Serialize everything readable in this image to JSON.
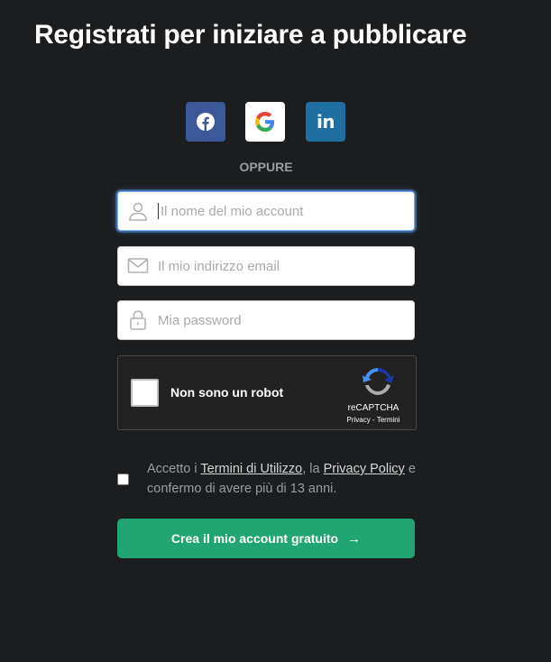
{
  "header": {
    "title": "Registrati per iniziare a pubblicare"
  },
  "social": {
    "facebook": {
      "icon": "facebook-icon",
      "color": "#3b5998"
    },
    "google": {
      "icon": "google-icon",
      "color": "#ffffff"
    },
    "linkedin": {
      "icon": "linkedin-icon",
      "label": "in",
      "color": "#1f6fa3"
    },
    "separator": "OPPURE"
  },
  "form": {
    "account_name": {
      "placeholder": "Il nome del mio account",
      "value": "",
      "icon": "user-icon"
    },
    "email": {
      "placeholder": "Il mio indirizzo email",
      "value": "",
      "icon": "envelope-icon"
    },
    "password": {
      "placeholder": "Mia password",
      "value": "",
      "icon": "lock-icon"
    }
  },
  "captcha": {
    "label": "Non sono un robot",
    "brand": "reCAPTCHA",
    "privacy": "Privacy",
    "sep": " - ",
    "terms": "Termini"
  },
  "terms": {
    "prefix": "Accetto i ",
    "link1": "Termini di Utilizzo",
    "middle": ", la ",
    "link2": "Privacy Policy",
    "suffix": " e confermo di avere più di 13 anni."
  },
  "submit": {
    "label": "Crea il mio account gratuito",
    "arrow": "→",
    "color": "#21a572"
  }
}
